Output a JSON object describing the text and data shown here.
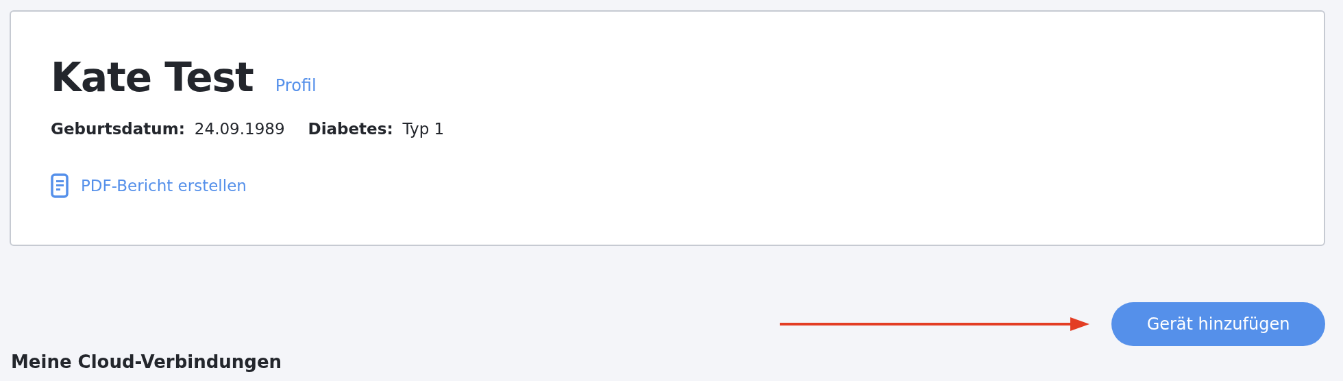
{
  "patient": {
    "name": "Kate Test",
    "profile_link": "Profil",
    "fields": [
      {
        "label": "Geburtsdatum:",
        "value": "24.09.1989"
      },
      {
        "label": "Diabetes:",
        "value": "Typ 1"
      }
    ],
    "report_link": "PDF-Bericht erstellen"
  },
  "add_device_button": "Gerät hinzufügen",
  "section_title": "Meine Cloud-Verbindungen"
}
